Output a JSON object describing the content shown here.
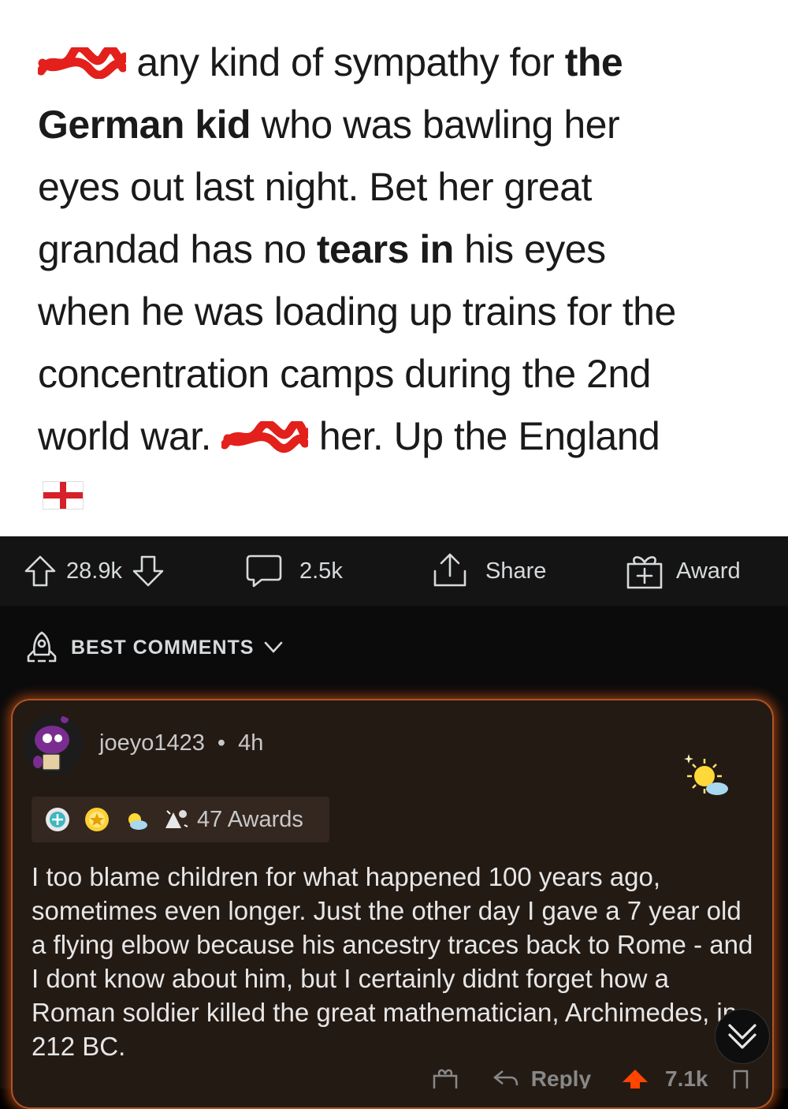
{
  "post": {
    "line1_after_redact": " any kind of sympathy for ",
    "line1_bold": "the",
    "line2_bold": "German kid",
    "line2_rest": " who was bawling her",
    "line3": "eyes out last night. Bet her great",
    "line4_start": "grandad has no ",
    "line4_bold": "tears in",
    "line4_end": " his eyes",
    "line5": "when he was loading up trains for the",
    "line6": "concentration camps during the 2nd",
    "line7_start": "world war. ",
    "line7_end": " her. Up the England"
  },
  "actions": {
    "upvotes": "28.9k",
    "comments": "2.5k",
    "share": "Share",
    "award": "Award"
  },
  "comments_header": {
    "sort_label": "BEST COMMENTS"
  },
  "comment": {
    "username": "joeyo1423",
    "separator": "•",
    "age": "4h",
    "awards_count": "47 Awards",
    "body": "I too blame children for what happened 100 years ago, sometimes even longer. Just the other day I gave a 7 year old a flying elbow because his ancestry traces back to Rome - and I dont know about him, but I certainly didnt forget how a Roman soldier killed the great mathematician, Archimedes, in 212 BC.",
    "reply_label": "Reply",
    "score": "7.1k"
  },
  "colors": {
    "redact": "#e3201b",
    "accent_border": "#b05424",
    "upvote_orange": "#ff4500"
  }
}
